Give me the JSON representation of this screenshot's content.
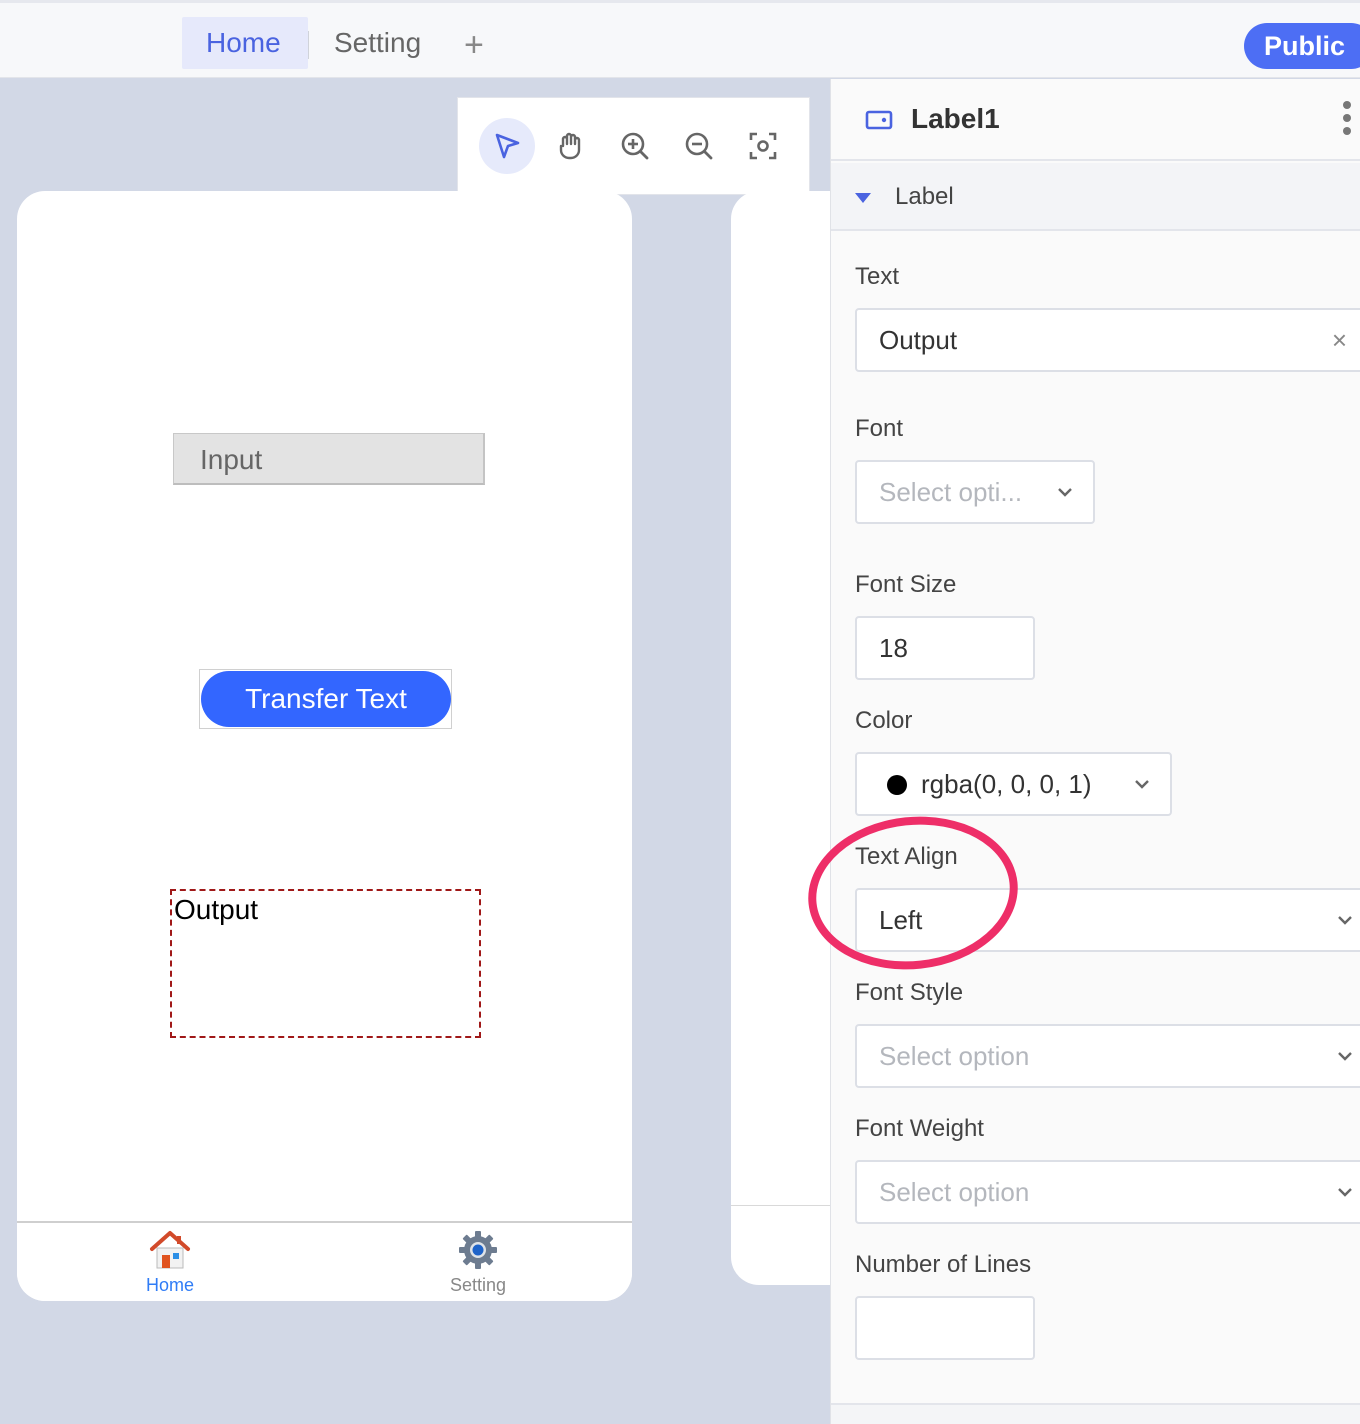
{
  "topbar": {
    "tabs": [
      {
        "label": "Home",
        "active": true
      },
      {
        "label": "Setting",
        "active": false
      }
    ],
    "add_icon": "plus-icon",
    "public_label": "Public"
  },
  "toolbar": {
    "tools": [
      {
        "icon": "pointer-icon",
        "selected": true
      },
      {
        "icon": "hand-icon",
        "selected": false
      },
      {
        "icon": "zoom-in-icon",
        "selected": false
      },
      {
        "icon": "zoom-out-icon",
        "selected": false
      },
      {
        "icon": "fit-screen-icon",
        "selected": false
      }
    ]
  },
  "phone": {
    "input_placeholder": "Input",
    "button_label": "Transfer Text",
    "output_text": "Output",
    "tabbar": [
      {
        "label": "Home",
        "icon": "home-icon",
        "active": true
      },
      {
        "label": "Setting",
        "icon": "gear-icon",
        "active": false
      }
    ]
  },
  "panel": {
    "component_icon": "label-component-icon",
    "component_name": "Label1",
    "section_title": "Label",
    "fields": {
      "text": {
        "label": "Text",
        "value": "Output"
      },
      "font": {
        "label": "Font",
        "placeholder": "Select opti..."
      },
      "font_size": {
        "label": "Font Size",
        "value": "18"
      },
      "color": {
        "label": "Color",
        "value": "rgba(0, 0, 0, 1)"
      },
      "text_align": {
        "label": "Text Align",
        "value": "Left"
      },
      "font_style": {
        "label": "Font Style",
        "placeholder": "Select option"
      },
      "font_weight": {
        "label": "Font Weight",
        "placeholder": "Select option"
      },
      "number_of_lines": {
        "label": "Number of Lines",
        "value": ""
      }
    }
  },
  "colors": {
    "accent": "#4d6ef4",
    "button": "#3366ff",
    "highlight_ring": "#ee2e68",
    "canvas_bg": "#d2d8e6"
  }
}
